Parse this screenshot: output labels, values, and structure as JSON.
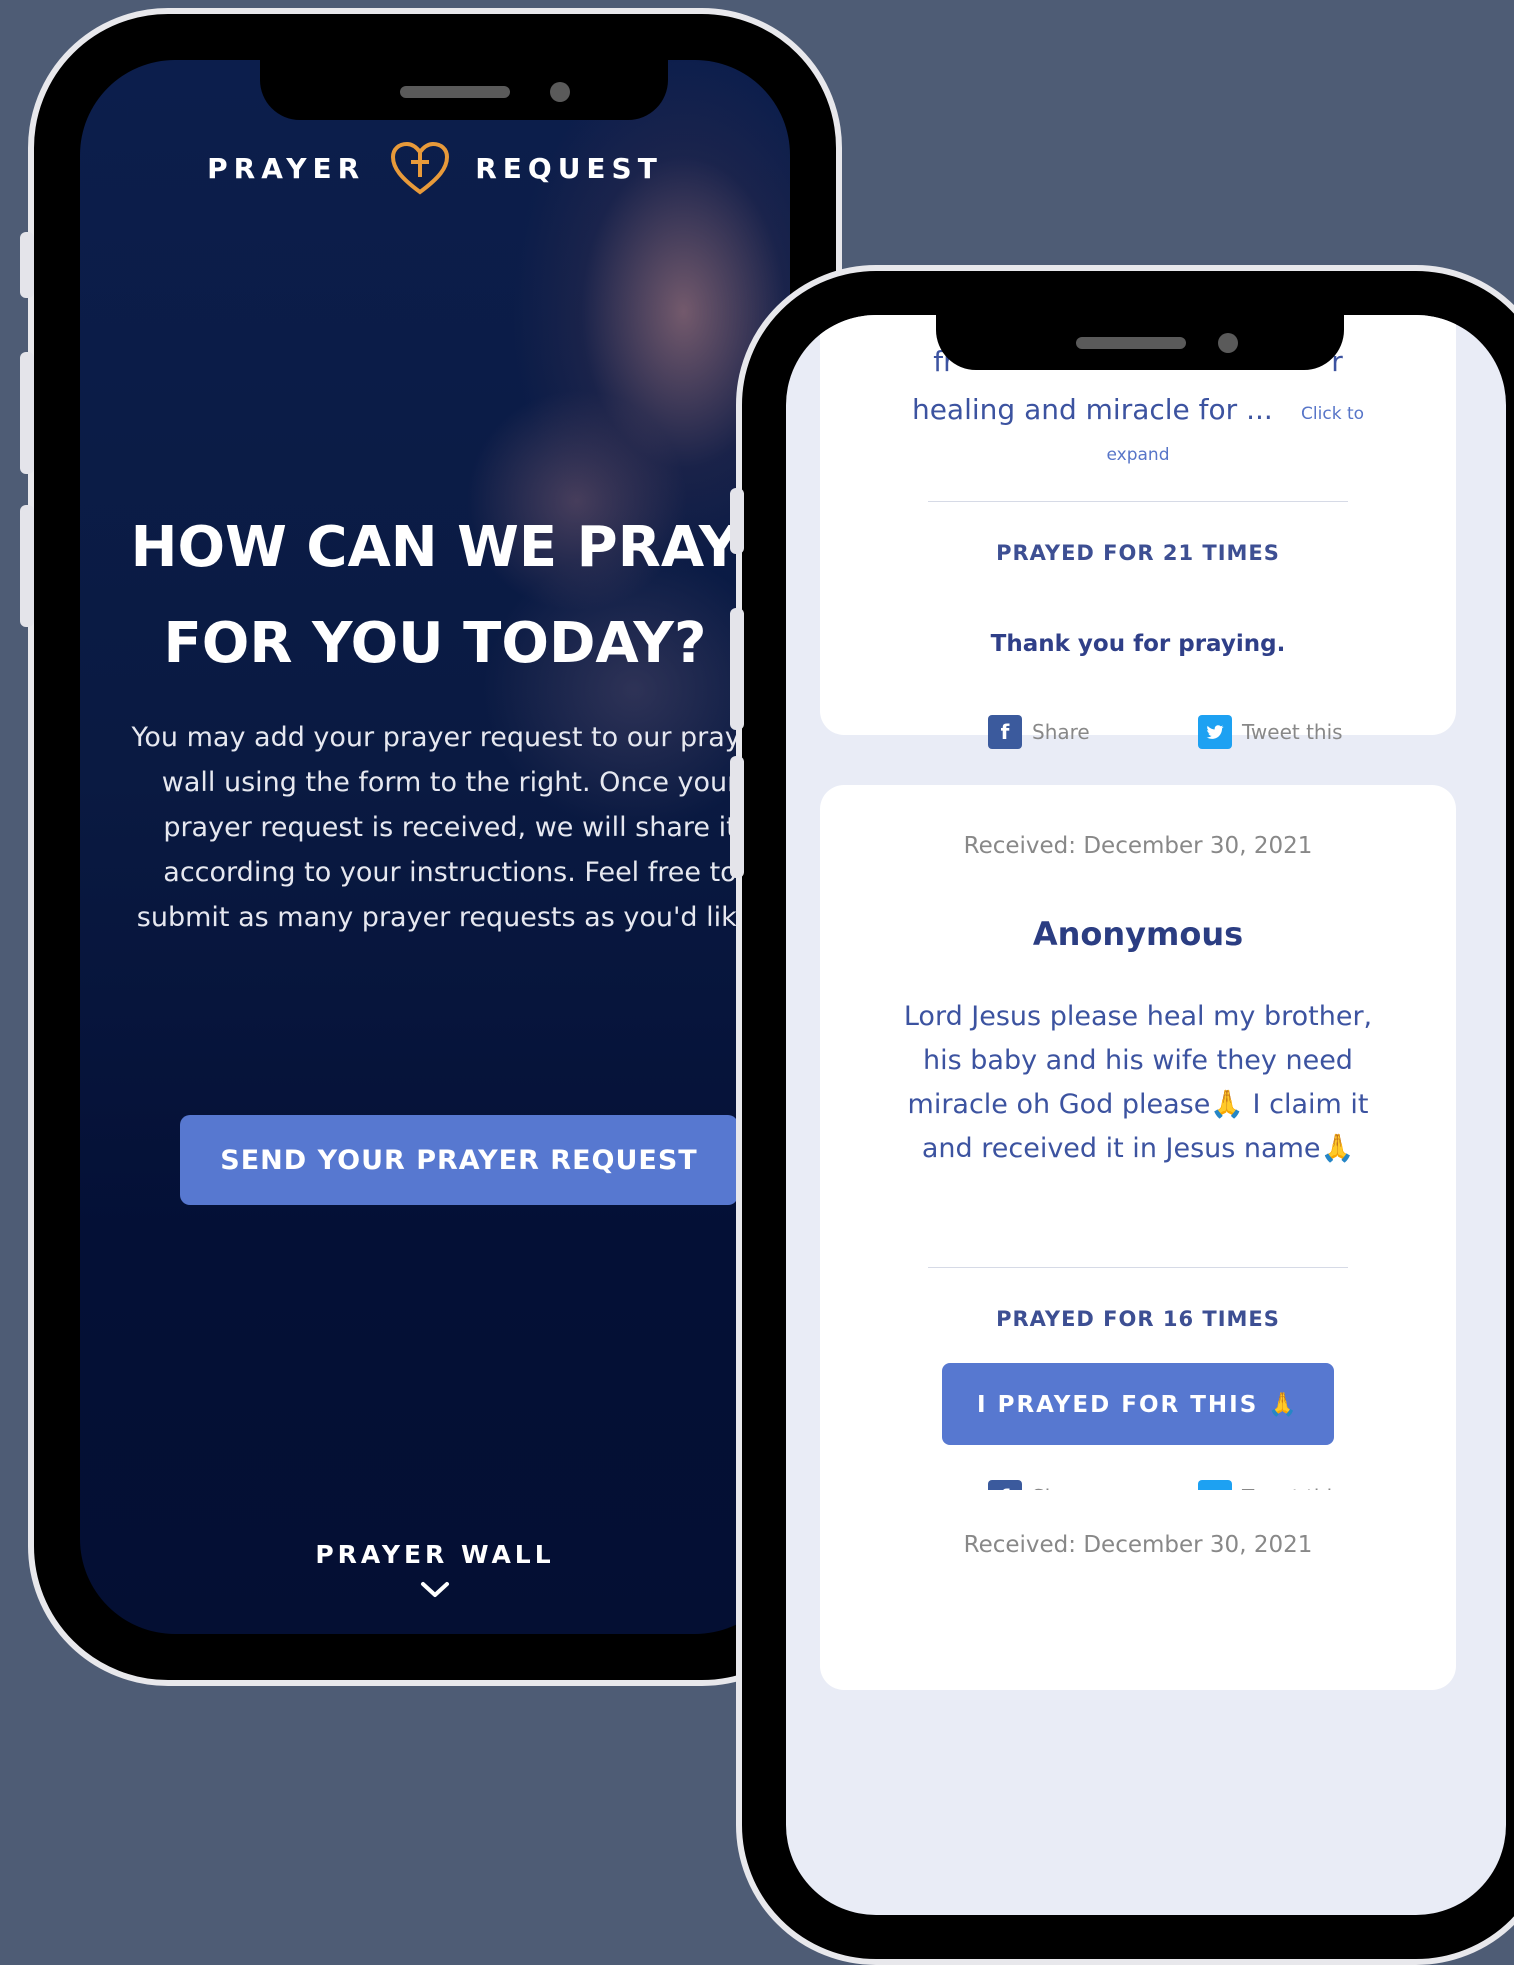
{
  "left_screen": {
    "brand": {
      "left_word": "PRAYER",
      "right_word": "REQUEST",
      "logo_icon": "heart-cross-icon",
      "logo_color": "#e89a3a"
    },
    "hero_title_line1": "HOW CAN WE PRAY",
    "hero_title_line2": "FOR YOU TODAY?",
    "hero_text": "You may add your prayer request to our prayer wall using the form to the right. Once your prayer request is received, we will share it according to your instructions. Feel free to submit as many prayer requests as you'd like!",
    "cta_label": "SEND YOUR PRAYER REQUEST",
    "cta_color": "#5778d0",
    "prayer_wall_label": "PRAYER WALL",
    "scroll_icon": "chevron-down-icon"
  },
  "right_screen": {
    "card1": {
      "partial_line1_left": "fr",
      "partial_line1_right": "r",
      "partial_text": "healing and miracle for ...",
      "click_to": "Click to",
      "expand": "expand",
      "prayed_count": "PRAYED FOR 21 TIMES",
      "thanks": "Thank you for praying.",
      "share_label": "Share",
      "tweet_label": "Tweet this"
    },
    "card2": {
      "received": "Received: December 30, 2021",
      "name": "Anonymous",
      "body": "Lord Jesus please heal my brother, his baby and his wife they need miracle oh God please🙏 I claim it and received it in Jesus name🙏",
      "prayed_count": "PRAYED FOR 16 TIMES",
      "pray_button": "I PRAYED FOR THIS 🙏",
      "share_label": "Share",
      "tweet_label": "Tweet this"
    },
    "card3": {
      "received": "Received: December 30, 2021"
    }
  },
  "colors": {
    "background": "#4e5c75",
    "accent": "#5778d0",
    "facebook": "#3b5a9d",
    "twitter": "#1da1f2"
  }
}
